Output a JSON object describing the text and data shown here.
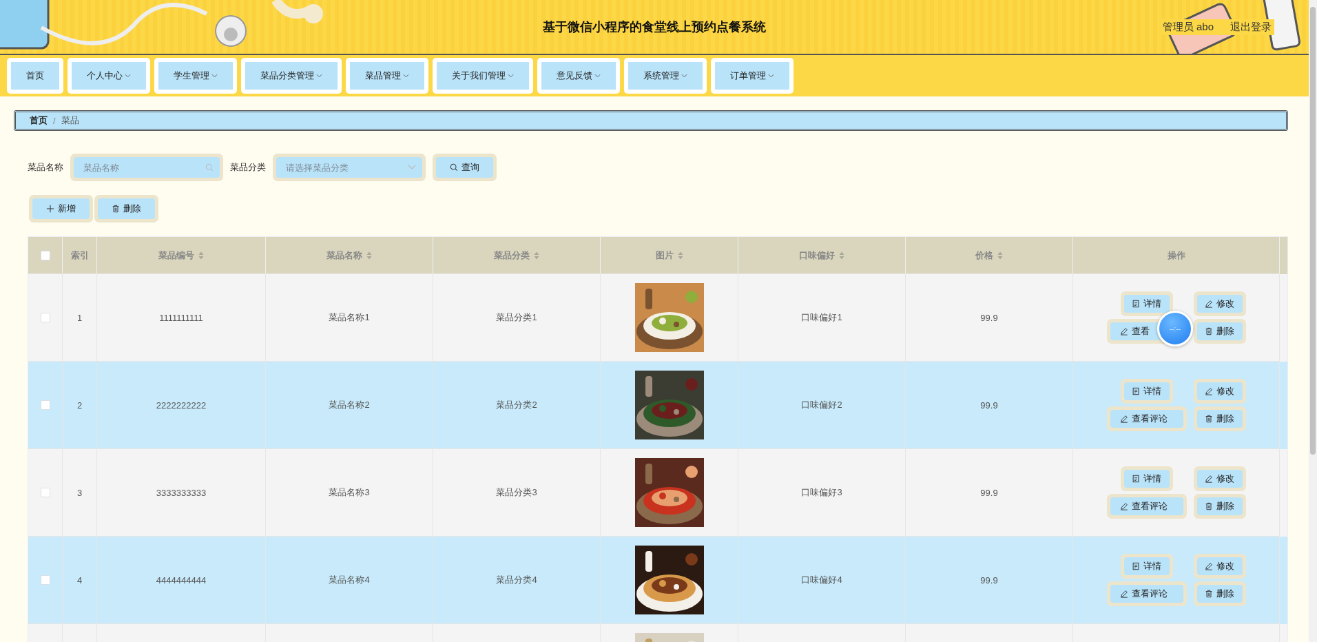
{
  "header": {
    "title": "基于微信小程序的食堂线上预约点餐系统",
    "user": "管理员 abo",
    "logout": "退出登录"
  },
  "nav": [
    {
      "label": "首页",
      "dropdown": false
    },
    {
      "label": "个人中心",
      "dropdown": true
    },
    {
      "label": "学生管理",
      "dropdown": true
    },
    {
      "label": "菜品分类管理",
      "dropdown": true
    },
    {
      "label": "菜品管理",
      "dropdown": true
    },
    {
      "label": "关于我们管理",
      "dropdown": true
    },
    {
      "label": "意见反馈",
      "dropdown": true
    },
    {
      "label": "系统管理",
      "dropdown": true
    },
    {
      "label": "订单管理",
      "dropdown": true
    }
  ],
  "breadcrumb": {
    "separator": "/",
    "items": [
      "首页",
      "菜品"
    ]
  },
  "search": {
    "fields": [
      {
        "kind": "input",
        "label": "菜品名称",
        "placeholder": "菜品名称"
      },
      {
        "kind": "select",
        "label": "菜品分类",
        "placeholder": "请选择菜品分类"
      }
    ],
    "button": "查询"
  },
  "actions": [
    {
      "kind": "add",
      "label": "新增"
    },
    {
      "kind": "delete",
      "label": "删除"
    }
  ],
  "table": {
    "header_checkbox": {
      "checked": false
    },
    "columns": [
      {
        "label": "索引",
        "sortable": false
      },
      {
        "label": "菜品编号",
        "sortable": true
      },
      {
        "label": "菜品名称",
        "sortable": true
      },
      {
        "label": "菜品分类",
        "sortable": true
      },
      {
        "label": "图片",
        "sortable": true
      },
      {
        "label": "口味偏好",
        "sortable": true
      },
      {
        "label": "价格",
        "sortable": true
      },
      {
        "label": "操作",
        "sortable": false
      }
    ],
    "rows": [
      {
        "checked": false,
        "index": "1",
        "code": "1111111111",
        "name": "菜品名称1",
        "category": "菜品分类1",
        "picture": {
          "kind": "picture"
        },
        "taste": "口味偏好1",
        "price": "99.9",
        "actions": [
          {
            "kind": "detail",
            "label": "详情"
          },
          {
            "kind": "edit",
            "label": "修改"
          },
          {
            "kind": "edit",
            "label": "查看"
          },
          {
            "kind": "delete",
            "label": "删除"
          }
        ]
      },
      {
        "checked": false,
        "index": "2",
        "code": "2222222222",
        "name": "菜品名称2",
        "category": "菜品分类2",
        "picture": {
          "kind": "picture"
        },
        "taste": "口味偏好2",
        "price": "99.9",
        "actions": [
          {
            "kind": "detail",
            "label": "详情"
          },
          {
            "kind": "edit",
            "label": "修改"
          },
          {
            "kind": "edit",
            "label": "查看评论"
          },
          {
            "kind": "delete",
            "label": "删除"
          }
        ]
      },
      {
        "checked": false,
        "index": "3",
        "code": "3333333333",
        "name": "菜品名称3",
        "category": "菜品分类3",
        "picture": {
          "kind": "picture"
        },
        "taste": "口味偏好3",
        "price": "99.9",
        "actions": [
          {
            "kind": "detail",
            "label": "详情"
          },
          {
            "kind": "edit",
            "label": "修改"
          },
          {
            "kind": "edit",
            "label": "查看评论"
          },
          {
            "kind": "delete",
            "label": "删除"
          }
        ]
      },
      {
        "checked": false,
        "index": "4",
        "code": "4444444444",
        "name": "菜品名称4",
        "category": "菜品分类4",
        "picture": {
          "kind": "picture"
        },
        "taste": "口味偏好4",
        "price": "99.9",
        "actions": [
          {
            "kind": "detail",
            "label": "详情"
          },
          {
            "kind": "edit",
            "label": "修改"
          },
          {
            "kind": "edit",
            "label": "查看评论"
          },
          {
            "kind": "delete",
            "label": "删除"
          }
        ]
      },
      {
        "picture": {
          "kind": "picture"
        }
      }
    ]
  },
  "timer": {
    "label": "--:--"
  }
}
